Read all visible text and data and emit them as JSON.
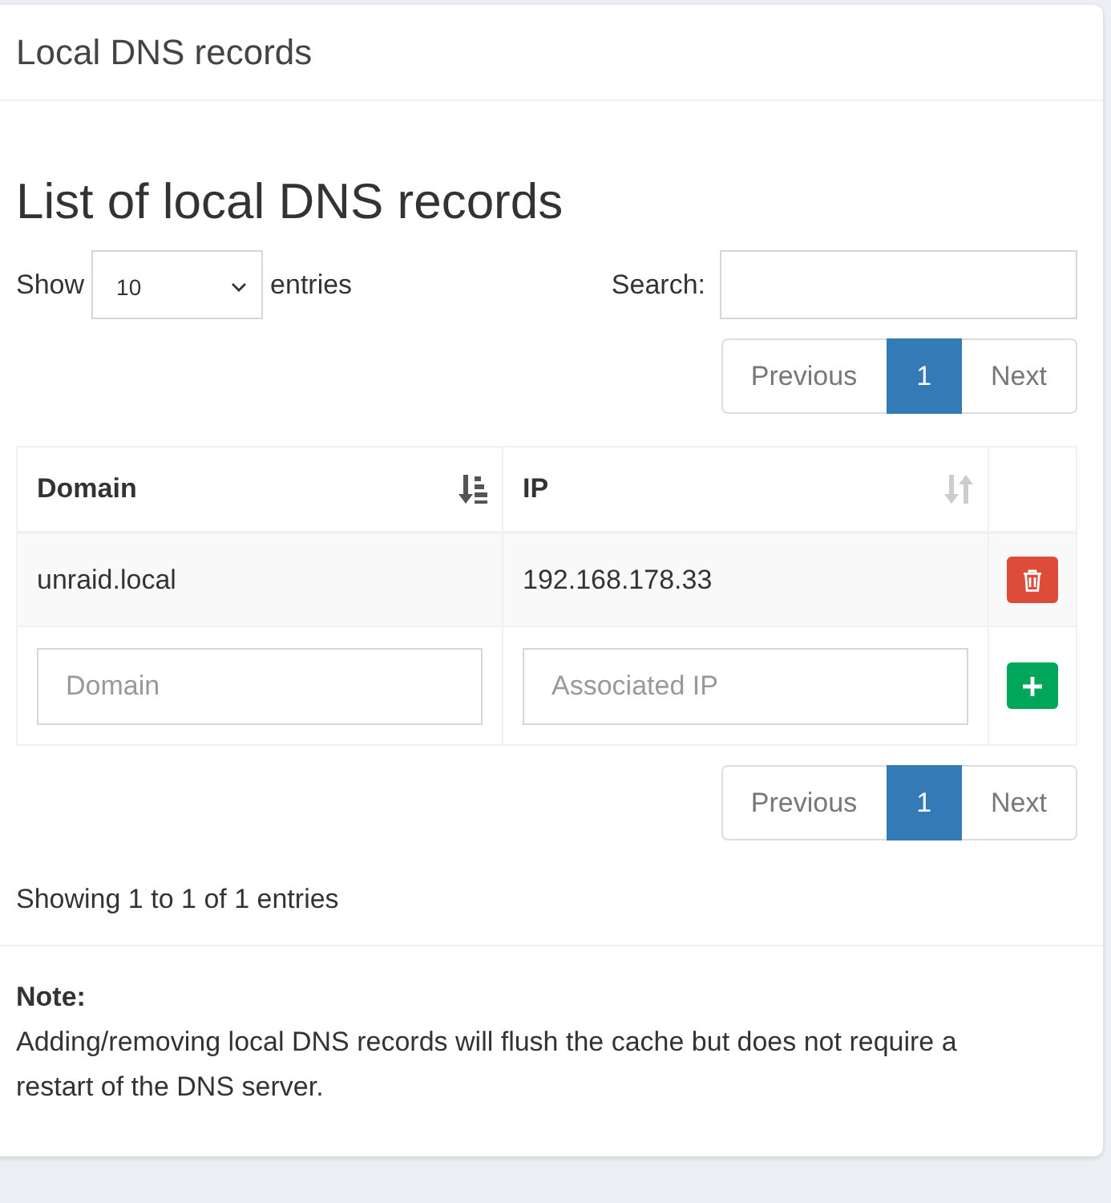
{
  "card": {
    "title": "Local DNS records"
  },
  "heading": "List of local DNS records",
  "length_control": {
    "label_before": "Show",
    "value": "10",
    "label_after": "entries"
  },
  "search": {
    "label": "Search:"
  },
  "pagination_top": [
    {
      "label": "Previous",
      "selected": false,
      "disabled": true
    },
    {
      "label": "1",
      "selected": true,
      "disabled": false
    },
    {
      "label": "Next",
      "selected": false,
      "disabled": true
    }
  ],
  "table": {
    "columns": [
      {
        "label": "Domain",
        "sorted": true
      },
      {
        "label": "IP",
        "sorted": false
      }
    ],
    "rows": [
      {
        "domain": "unraid.local",
        "ip": "192.168.178.33"
      }
    ],
    "new_row": {
      "domain_placeholder": "Domain",
      "ip_placeholder": "Associated IP"
    }
  },
  "pagination_bottom": [
    {
      "label": "Previous",
      "selected": false,
      "disabled": true
    },
    {
      "label": "1",
      "selected": true,
      "disabled": false
    },
    {
      "label": "Next",
      "selected": false,
      "disabled": true
    }
  ],
  "info": "Showing 1 to 1 of 1 entries",
  "note": {
    "title": "Note:",
    "text": "Adding/removing local DNS records will flush the cache but does not require a restart of the DNS server."
  }
}
